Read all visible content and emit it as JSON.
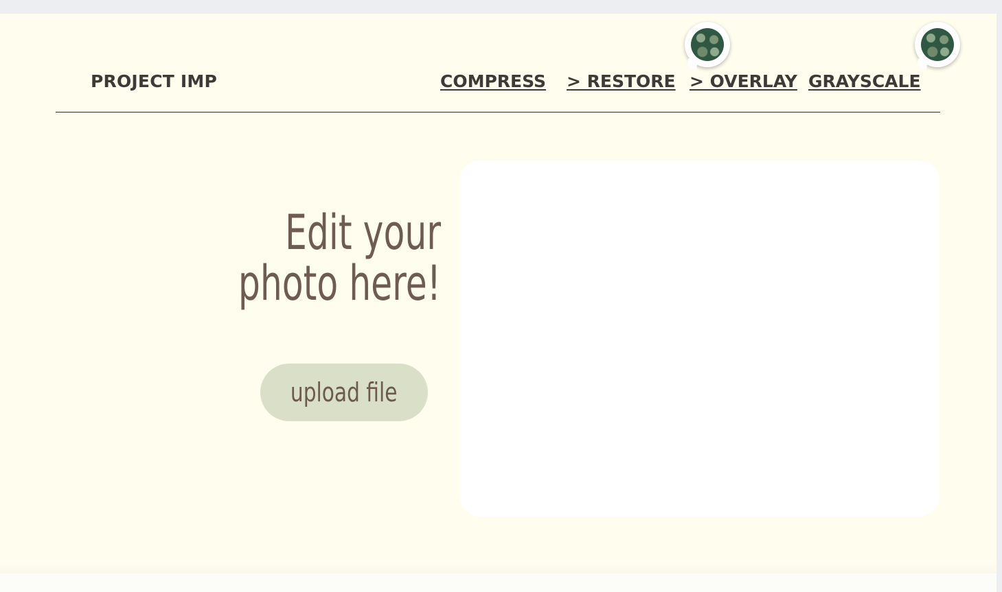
{
  "header": {
    "brand": "PROJECT IMP",
    "nav": [
      {
        "label": "COMPRESS"
      },
      {
        "label": "> RESTORE"
      },
      {
        "label": "> OVERLAY"
      },
      {
        "label": "GRAYSCALE"
      }
    ]
  },
  "hero": {
    "title_line1": "Edit your",
    "title_line2": "photo here!",
    "upload_label": "upload file"
  },
  "colors": {
    "page_background": "#fffdee",
    "text_dark": "#3e3a37",
    "title_brown": "#6e5c52",
    "upload_button_bg": "#dadfc8",
    "panel_bg": "#ffffff"
  }
}
